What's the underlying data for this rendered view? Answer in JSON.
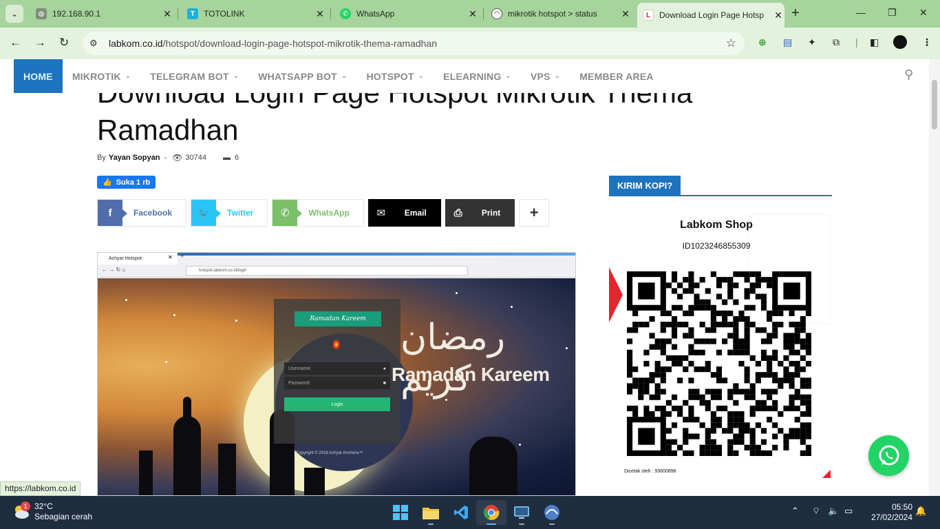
{
  "browser": {
    "tabs": [
      {
        "title": "192.168.90.1"
      },
      {
        "title": "TOTOLINK"
      },
      {
        "title": "WhatsApp"
      },
      {
        "title": "mikrotik hotspot > status"
      },
      {
        "title": "Download Login Page Hotsp"
      }
    ],
    "url_domain": "labkom.co.id",
    "url_path": "/hotspot/download-login-page-hotspot-mikrotik-thema-ramadhan"
  },
  "nav": {
    "items": [
      {
        "label": "HOME"
      },
      {
        "label": "MIKROTIK"
      },
      {
        "label": "TELEGRAM BOT"
      },
      {
        "label": "WHATSAPP BOT"
      },
      {
        "label": "HOTSPOT"
      },
      {
        "label": "ELEARNING"
      },
      {
        "label": "VPS"
      },
      {
        "label": "MEMBER AREA"
      }
    ]
  },
  "article": {
    "title": "Download Login Page Hotspot Mikrotik Thema Ramadhan",
    "by_label": "By",
    "author": "Yayan Sopyan",
    "views": "30744",
    "comments": "6",
    "like_label": "Suka 1 rb"
  },
  "share": {
    "facebook": "Facebook",
    "twitter": "Twitter",
    "whatsapp": "WhatsApp",
    "email": "Email",
    "print": "Print"
  },
  "screenshot": {
    "tab_title": "Achyar Hotspot",
    "url": "hotspot.labkom.co.id/login",
    "banner": "Ramadan Kareem",
    "username_placeholder": "Username",
    "password_placeholder": "Password",
    "login_label": "Login",
    "copyright": "Copyright © 2018 Achyar Anshorie™",
    "arabic_text": "رمضان كريم",
    "kareem_text": "Ramadan Kareem"
  },
  "sidebar": {
    "section_title": "KIRIM KOPI?",
    "shop_name": "Labkom Shop",
    "shop_id": "ID1023246855309",
    "printed_by": "Dicetak oleh : 93600898"
  },
  "status_url": "https://labkom.co.id",
  "taskbar": {
    "temperature": "32°C",
    "weather": "Sebagian cerah",
    "weather_badge": "1",
    "time": "05:50",
    "date": "27/02/2024"
  }
}
